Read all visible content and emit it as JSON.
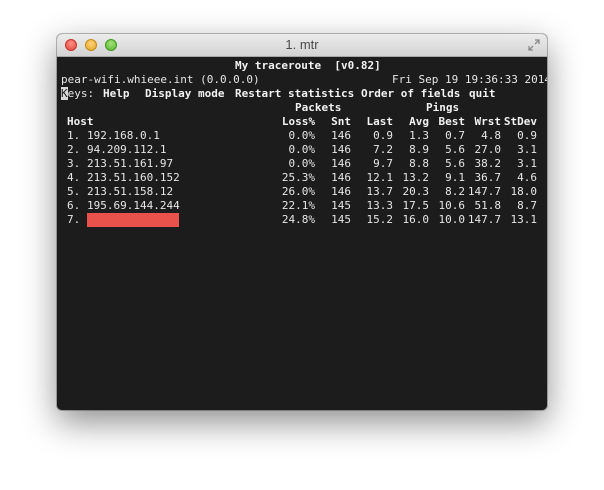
{
  "window": {
    "title": "1. mtr"
  },
  "mtr": {
    "heading": "My traceroute  [v0.82]",
    "host_line": "pear-wifi.whieee.int (0.0.0.0)",
    "datetime": "Fri Sep 19 19:36:33 2014",
    "keys_label": "Keys:",
    "menu": [
      "Help",
      "Display mode",
      "Restart statistics",
      "Order of fields",
      "quit"
    ],
    "group_headers": {
      "packets": "Packets",
      "pings": "Pings"
    },
    "columns": [
      "Host",
      "Loss%",
      "Snt",
      "Last",
      "Avg",
      "Best",
      "Wrst",
      "StDev"
    ],
    "rows": [
      {
        "num": "1.",
        "host": "192.168.0.1",
        "loss": "0.0%",
        "snt": "146",
        "last": "0.9",
        "avg": "1.3",
        "best": "0.7",
        "wrst": "4.8",
        "stdev": "0.9"
      },
      {
        "num": "2.",
        "host": "94.209.112.1",
        "loss": "0.0%",
        "snt": "146",
        "last": "7.2",
        "avg": "8.9",
        "best": "5.6",
        "wrst": "27.0",
        "stdev": "3.1"
      },
      {
        "num": "3.",
        "host": "213.51.161.97",
        "loss": "0.0%",
        "snt": "146",
        "last": "9.7",
        "avg": "8.8",
        "best": "5.6",
        "wrst": "38.2",
        "stdev": "3.1"
      },
      {
        "num": "4.",
        "host": "213.51.160.152",
        "loss": "25.3%",
        "snt": "146",
        "last": "12.1",
        "avg": "13.2",
        "best": "9.1",
        "wrst": "36.7",
        "stdev": "4.6"
      },
      {
        "num": "5.",
        "host": "213.51.158.12",
        "loss": "26.0%",
        "snt": "146",
        "last": "13.7",
        "avg": "20.3",
        "best": "8.2",
        "wrst": "147.7",
        "stdev": "18.0"
      },
      {
        "num": "6.",
        "host": "195.69.144.244",
        "loss": "22.1%",
        "snt": "145",
        "last": "13.3",
        "avg": "17.5",
        "best": "10.6",
        "wrst": "51.8",
        "stdev": "8.7"
      },
      {
        "num": "7.",
        "host": "",
        "loss": "24.8%",
        "snt": "145",
        "last": "15.2",
        "avg": "16.0",
        "best": "10.0",
        "wrst": "147.7",
        "stdev": "13.1",
        "redacted": true
      }
    ]
  },
  "icons": {
    "close": "close-button-icon",
    "minimize": "minimize-button-icon",
    "zoom": "zoom-button-icon",
    "fullscreen": "fullscreen-arrows-icon"
  },
  "colors": {
    "terminal_bg": "#1c1c1c",
    "terminal_fg": "#e6e6e6",
    "redaction": "#e8524a"
  }
}
